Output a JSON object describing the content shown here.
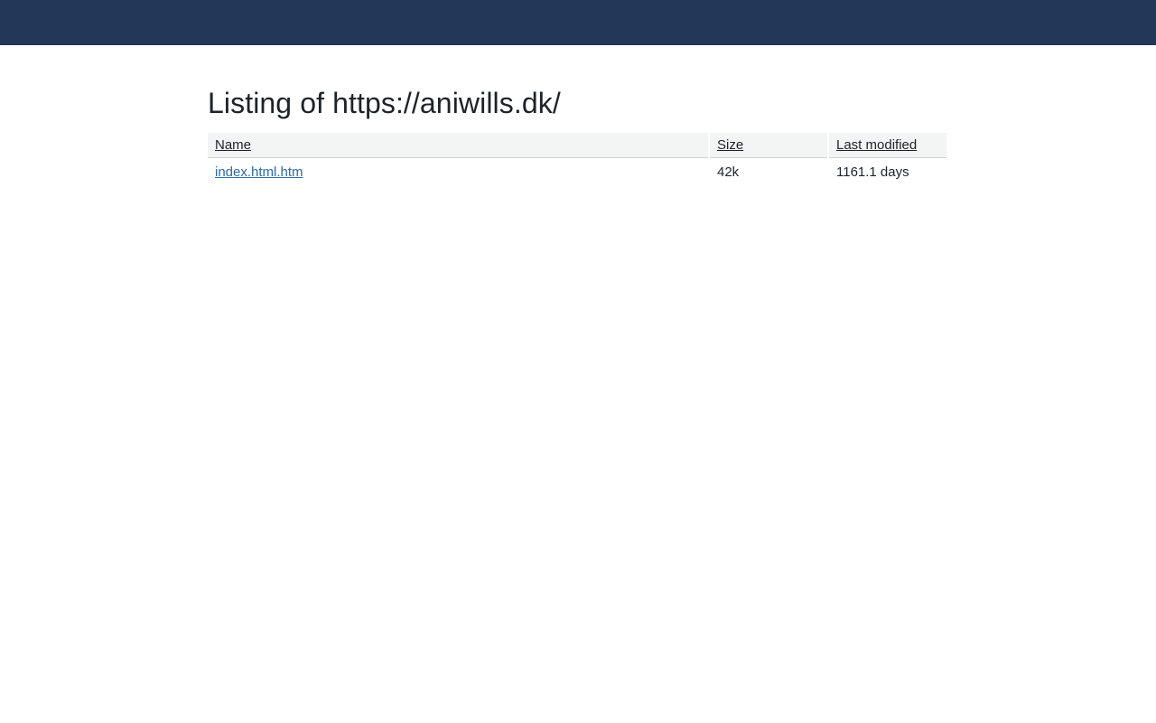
{
  "header": {
    "color": "#233859"
  },
  "page": {
    "title": "Listing of https://aniwills.dk/"
  },
  "table": {
    "columns": {
      "name": "Name",
      "size": "Size",
      "modified": "Last modified"
    },
    "rows": [
      {
        "name": "index.html.htm",
        "size": "42k",
        "modified": "1161.1 days"
      }
    ]
  }
}
